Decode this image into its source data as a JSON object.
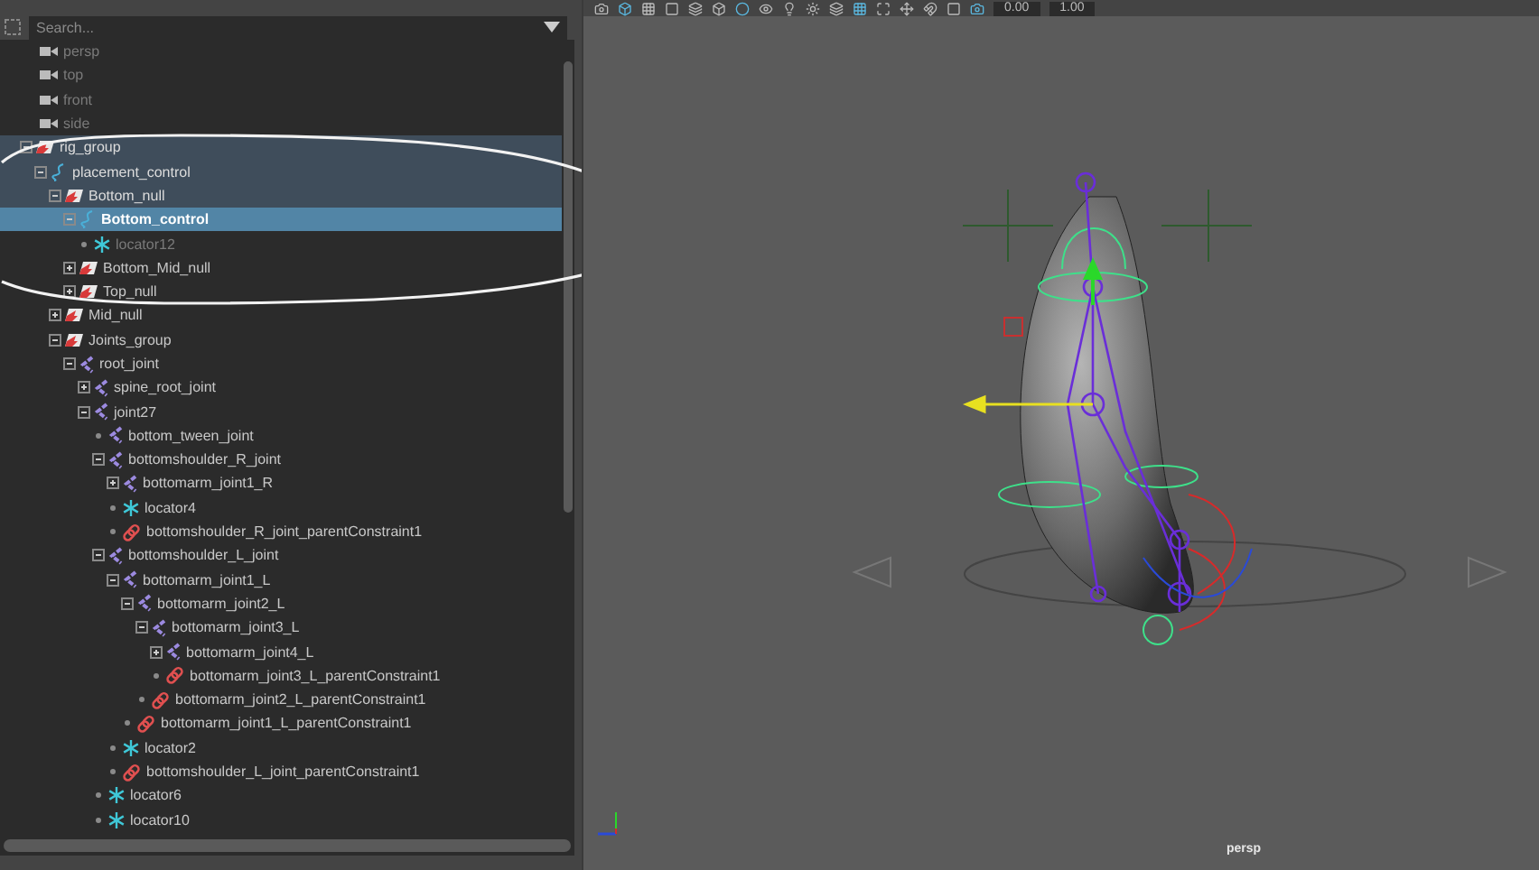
{
  "outliner": {
    "search": {
      "placeholder": "Search..."
    },
    "tree": [
      {
        "label": "persp",
        "kind": "camera",
        "selected": false,
        "highlighted": false,
        "dimmed": true
      },
      {
        "label": "top",
        "kind": "camera",
        "selected": false,
        "highlighted": false,
        "dimmed": true
      },
      {
        "label": "front",
        "kind": "camera",
        "selected": false,
        "highlighted": false,
        "dimmed": true
      },
      {
        "label": "side",
        "kind": "camera",
        "selected": false,
        "highlighted": false,
        "dimmed": true
      },
      {
        "label": "rig_group",
        "kind": "group",
        "expandable": true,
        "expanded": true,
        "selected": false,
        "highlighted": true,
        "dimmed": false,
        "children": [
          {
            "label": "placement_control",
            "kind": "curve",
            "expandable": true,
            "expanded": true,
            "selected": false,
            "highlighted": true,
            "dimmed": false,
            "children": [
              {
                "label": "Bottom_null",
                "kind": "group",
                "expandable": true,
                "expanded": true,
                "selected": false,
                "highlighted": true,
                "dimmed": false,
                "children": [
                  {
                    "label": "Bottom_control",
                    "kind": "curve",
                    "expandable": true,
                    "expanded": true,
                    "selected": true,
                    "highlighted": false,
                    "dimmed": false,
                    "children": [
                      {
                        "label": "locator12",
                        "kind": "locator",
                        "expandable": false,
                        "expanded": false,
                        "selected": false,
                        "highlighted": false,
                        "dimmed": true
                      }
                    ]
                  },
                  {
                    "label": "Bottom_Mid_null",
                    "kind": "group",
                    "expandable": true,
                    "expanded": false,
                    "selected": false,
                    "highlighted": false,
                    "dimmed": false
                  },
                  {
                    "label": "Top_null",
                    "kind": "group",
                    "expandable": true,
                    "expanded": false,
                    "selected": false,
                    "highlighted": false,
                    "dimmed": false
                  }
                ]
              },
              {
                "label": "Mid_null",
                "kind": "group",
                "expandable": true,
                "expanded": false,
                "selected": false,
                "highlighted": false,
                "dimmed": false
              },
              {
                "label": "Joints_group",
                "kind": "group",
                "expandable": true,
                "expanded": true,
                "selected": false,
                "highlighted": false,
                "dimmed": false,
                "children": [
                  {
                    "label": "root_joint",
                    "kind": "joint",
                    "expandable": true,
                    "expanded": true,
                    "selected": false,
                    "highlighted": false,
                    "dimmed": false,
                    "children": [
                      {
                        "label": "spine_root_joint",
                        "kind": "joint",
                        "expandable": true,
                        "expanded": false,
                        "selected": false,
                        "highlighted": false,
                        "dimmed": false
                      },
                      {
                        "label": "joint27",
                        "kind": "joint",
                        "expandable": true,
                        "expanded": true,
                        "selected": false,
                        "highlighted": false,
                        "dimmed": false,
                        "children": [
                          {
                            "label": "bottom_tween_joint",
                            "kind": "joint",
                            "expandable": false,
                            "expanded": false,
                            "selected": false,
                            "highlighted": false,
                            "dimmed": false
                          },
                          {
                            "label": "bottomshoulder_R_joint",
                            "kind": "joint",
                            "expandable": true,
                            "expanded": true,
                            "selected": false,
                            "highlighted": false,
                            "dimmed": false,
                            "children": [
                              {
                                "label": "bottomarm_joint1_R",
                                "kind": "joint",
                                "expandable": true,
                                "expanded": false,
                                "selected": false,
                                "highlighted": false,
                                "dimmed": false
                              },
                              {
                                "label": "locator4",
                                "kind": "locator",
                                "expandable": false,
                                "expanded": false,
                                "selected": false,
                                "highlighted": false,
                                "dimmed": false
                              },
                              {
                                "label": "bottomshoulder_R_joint_parentConstraint1",
                                "kind": "constraint",
                                "expandable": false,
                                "expanded": false,
                                "selected": false,
                                "highlighted": false,
                                "dimmed": false
                              }
                            ]
                          },
                          {
                            "label": "bottomshoulder_L_joint",
                            "kind": "joint",
                            "expandable": true,
                            "expanded": true,
                            "selected": false,
                            "highlighted": false,
                            "dimmed": false,
                            "children": [
                              {
                                "label": "bottomarm_joint1_L",
                                "kind": "joint",
                                "expandable": true,
                                "expanded": true,
                                "selected": false,
                                "highlighted": false,
                                "dimmed": false,
                                "children": [
                                  {
                                    "label": "bottomarm_joint2_L",
                                    "kind": "joint",
                                    "expandable": true,
                                    "expanded": true,
                                    "selected": false,
                                    "highlighted": false,
                                    "dimmed": false,
                                    "children": [
                                      {
                                        "label": "bottomarm_joint3_L",
                                        "kind": "joint",
                                        "expandable": true,
                                        "expanded": true,
                                        "selected": false,
                                        "highlighted": false,
                                        "dimmed": false,
                                        "children": [
                                          {
                                            "label": "bottomarm_joint4_L",
                                            "kind": "joint",
                                            "expandable": true,
                                            "expanded": false,
                                            "selected": false,
                                            "highlighted": false,
                                            "dimmed": false
                                          },
                                          {
                                            "label": "bottomarm_joint3_L_parentConstraint1",
                                            "kind": "constraint",
                                            "expandable": false,
                                            "expanded": false,
                                            "selected": false,
                                            "highlighted": false,
                                            "dimmed": false
                                          }
                                        ]
                                      },
                                      {
                                        "label": "bottomarm_joint2_L_parentConstraint1",
                                        "kind": "constraint",
                                        "expandable": false,
                                        "expanded": false,
                                        "selected": false,
                                        "highlighted": false,
                                        "dimmed": false
                                      }
                                    ]
                                  },
                                  {
                                    "label": "bottomarm_joint1_L_parentConstraint1",
                                    "kind": "constraint",
                                    "expandable": false,
                                    "expanded": false,
                                    "selected": false,
                                    "highlighted": false,
                                    "dimmed": false
                                  }
                                ]
                              },
                              {
                                "label": "locator2",
                                "kind": "locator",
                                "expandable": false,
                                "expanded": false,
                                "selected": false,
                                "highlighted": false,
                                "dimmed": false
                              },
                              {
                                "label": "bottomshoulder_L_joint_parentConstraint1",
                                "kind": "constraint",
                                "expandable": false,
                                "expanded": false,
                                "selected": false,
                                "highlighted": false,
                                "dimmed": false
                              }
                            ]
                          },
                          {
                            "label": "locator6",
                            "kind": "locator",
                            "expandable": false,
                            "expanded": false,
                            "selected": false,
                            "highlighted": false,
                            "dimmed": false
                          },
                          {
                            "label": "locator10",
                            "kind": "locator",
                            "expandable": false,
                            "expanded": false,
                            "selected": false,
                            "highlighted": false,
                            "dimmed": false
                          }
                        ]
                      }
                    ]
                  }
                ]
              }
            ]
          }
        ]
      }
    ]
  },
  "viewport": {
    "toolbar_fields": [
      "0.00",
      "1.00"
    ],
    "camera_label": "persp"
  }
}
